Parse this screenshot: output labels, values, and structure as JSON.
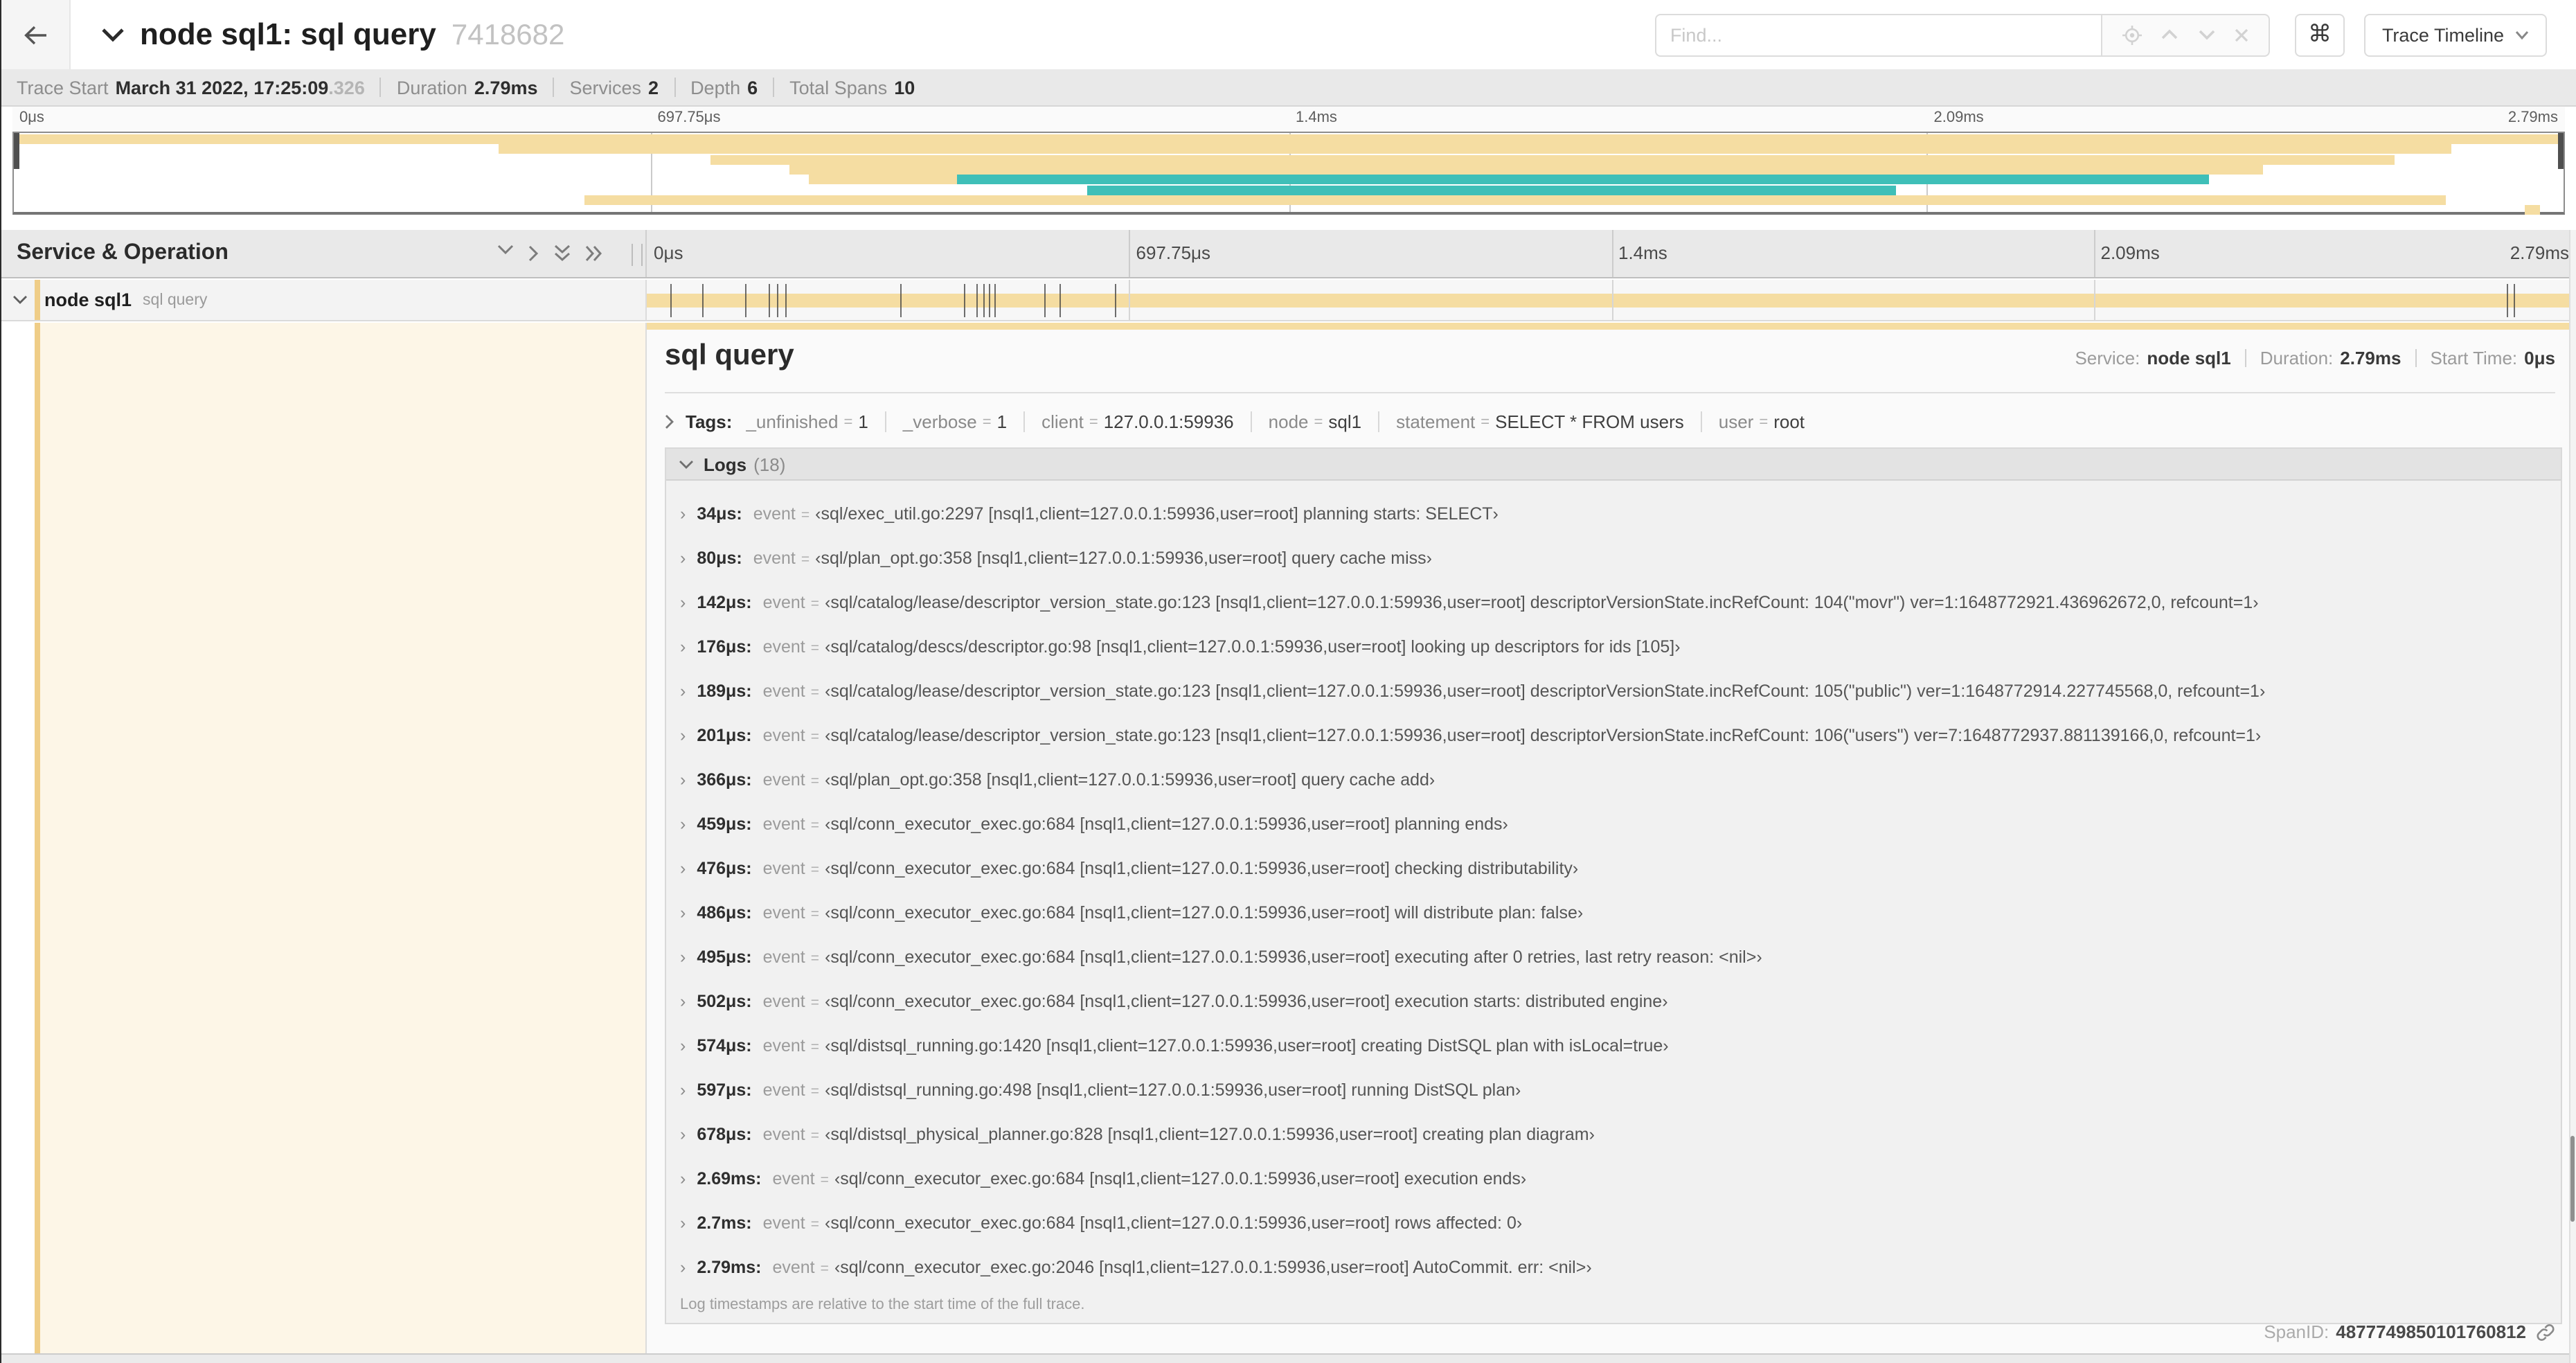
{
  "header": {
    "title": "node sql1: sql query",
    "trace_id": "7418682",
    "find_placeholder": "Find...",
    "shortcut_button": "⌘",
    "view_select": "Trace Timeline"
  },
  "trace_info": {
    "items": [
      {
        "label": "Trace Start",
        "value": "March 31 2022, 17:25:09",
        "suffix": ".326"
      },
      {
        "label": "Duration",
        "value": "2.79ms",
        "suffix": ""
      },
      {
        "label": "Services",
        "value": "2",
        "suffix": ""
      },
      {
        "label": "Depth",
        "value": "6",
        "suffix": ""
      },
      {
        "label": "Total Spans",
        "value": "10",
        "suffix": ""
      }
    ]
  },
  "timeline": {
    "ruler_ticks": [
      {
        "label": "0μs",
        "pos": 0
      },
      {
        "label": "697.75μs",
        "pos": 25
      },
      {
        "label": "1.4ms",
        "pos": 50
      },
      {
        "label": "2.09ms",
        "pos": 75
      },
      {
        "label": "2.79ms",
        "pos": 100
      }
    ],
    "gridline_positions": [
      25,
      50,
      75
    ],
    "log_marker_fracs": [
      1.22,
      2.87,
      5.09,
      6.31,
      6.77,
      7.2,
      13.12,
      16.45,
      17.06,
      17.42,
      17.74,
      18.0,
      20.57,
      21.4,
      24.3,
      96.42,
      96.77
    ],
    "minimap_bars": [
      {
        "row": 0,
        "start": 0,
        "end": 100,
        "color": "tan"
      },
      {
        "row": 1,
        "start": 19.0,
        "end": 95.6,
        "color": "tan"
      },
      {
        "row": 2,
        "start": 27.3,
        "end": 93.4,
        "color": "tan"
      },
      {
        "row": 3,
        "start": 30.4,
        "end": 88.2,
        "color": "tan"
      },
      {
        "row": 4,
        "start": 31.2,
        "end": 37.0,
        "color": "tan"
      },
      {
        "row": 4,
        "start": 37.0,
        "end": 86.1,
        "color": "teal"
      },
      {
        "row": 5,
        "start": 42.1,
        "end": 73.8,
        "color": "teal"
      },
      {
        "row": 6,
        "start": 22.4,
        "end": 95.4,
        "color": "tan"
      },
      {
        "row": 7,
        "start": 98.5,
        "end": 99.1,
        "color": "tan"
      }
    ]
  },
  "span_list": {
    "column_header": "Service & Operation",
    "row": {
      "service": "node sql1",
      "operation": "sql query"
    }
  },
  "detail": {
    "operation": "sql query",
    "summary": [
      {
        "label": "Service:",
        "value": "node sql1"
      },
      {
        "label": "Duration:",
        "value": "2.79ms"
      },
      {
        "label": "Start Time:",
        "value": "0μs"
      }
    ],
    "tags_label": "Tags:",
    "tag_eq": "=",
    "tags": [
      {
        "key": "_unfinished",
        "value": "1"
      },
      {
        "key": "_verbose",
        "value": "1"
      },
      {
        "key": "client",
        "value": "127.0.0.1:59936"
      },
      {
        "key": "node",
        "value": "sql1"
      },
      {
        "key": "statement",
        "value": "SELECT * FROM users"
      },
      {
        "key": "user",
        "value": "root"
      }
    ],
    "logs_label": "Logs",
    "logs_count": "(18)",
    "log_field": "event",
    "log_eq": "=",
    "logs": [
      {
        "time": "34μs:",
        "value": "‹sql/exec_util.go:2297 [nsql1,client=127.0.0.1:59936,user=root] planning starts: SELECT›"
      },
      {
        "time": "80μs:",
        "value": "‹sql/plan_opt.go:358 [nsql1,client=127.0.0.1:59936,user=root] query cache miss›"
      },
      {
        "time": "142μs:",
        "value": "‹sql/catalog/lease/descriptor_version_state.go:123 [nsql1,client=127.0.0.1:59936,user=root] descriptorVersionState.incRefCount: 104(\"movr\") ver=1:1648772921.436962672,0, refcount=1›"
      },
      {
        "time": "176μs:",
        "value": "‹sql/catalog/descs/descriptor.go:98 [nsql1,client=127.0.0.1:59936,user=root] looking up descriptors for ids [105]›"
      },
      {
        "time": "189μs:",
        "value": "‹sql/catalog/lease/descriptor_version_state.go:123 [nsql1,client=127.0.0.1:59936,user=root] descriptorVersionState.incRefCount: 105(\"public\") ver=1:1648772914.227745568,0, refcount=1›"
      },
      {
        "time": "201μs:",
        "value": "‹sql/catalog/lease/descriptor_version_state.go:123 [nsql1,client=127.0.0.1:59936,user=root] descriptorVersionState.incRefCount: 106(\"users\") ver=7:1648772937.881139166,0, refcount=1›"
      },
      {
        "time": "366μs:",
        "value": "‹sql/plan_opt.go:358 [nsql1,client=127.0.0.1:59936,user=root] query cache add›"
      },
      {
        "time": "459μs:",
        "value": "‹sql/conn_executor_exec.go:684 [nsql1,client=127.0.0.1:59936,user=root] planning ends›"
      },
      {
        "time": "476μs:",
        "value": "‹sql/conn_executor_exec.go:684 [nsql1,client=127.0.0.1:59936,user=root] checking distributability›"
      },
      {
        "time": "486μs:",
        "value": "‹sql/conn_executor_exec.go:684 [nsql1,client=127.0.0.1:59936,user=root] will distribute plan: false›"
      },
      {
        "time": "495μs:",
        "value": "‹sql/conn_executor_exec.go:684 [nsql1,client=127.0.0.1:59936,user=root] executing after 0 retries, last retry reason: <nil>›"
      },
      {
        "time": "502μs:",
        "value": "‹sql/conn_executor_exec.go:684 [nsql1,client=127.0.0.1:59936,user=root] execution starts: distributed engine›"
      },
      {
        "time": "574μs:",
        "value": "‹sql/distsql_running.go:1420 [nsql1,client=127.0.0.1:59936,user=root] creating DistSQL plan with isLocal=true›"
      },
      {
        "time": "597μs:",
        "value": "‹sql/distsql_running.go:498 [nsql1,client=127.0.0.1:59936,user=root] running DistSQL plan›"
      },
      {
        "time": "678μs:",
        "value": "‹sql/distsql_physical_planner.go:828 [nsql1,client=127.0.0.1:59936,user=root] creating plan diagram›"
      },
      {
        "time": "2.69ms:",
        "value": "‹sql/conn_executor_exec.go:684 [nsql1,client=127.0.0.1:59936,user=root] execution ends›"
      },
      {
        "time": "2.7ms:",
        "value": "‹sql/conn_executor_exec.go:684 [nsql1,client=127.0.0.1:59936,user=root] rows affected: 0›"
      },
      {
        "time": "2.79ms:",
        "value": "‹sql/conn_executor_exec.go:2046 [nsql1,client=127.0.0.1:59936,user=root] AutoCommit. err: <nil>›"
      }
    ],
    "logs_note": "Log timestamps are relative to the start time of the full trace.",
    "spanid_label": "SpanID:",
    "spanid": "4877749850101760812"
  },
  "icons": {
    "expander": "›"
  },
  "colors": {
    "tan": "#f5dda2",
    "teal": "#3fbfb8",
    "accent": "#efcd87",
    "cream": "#fdf6e7"
  }
}
